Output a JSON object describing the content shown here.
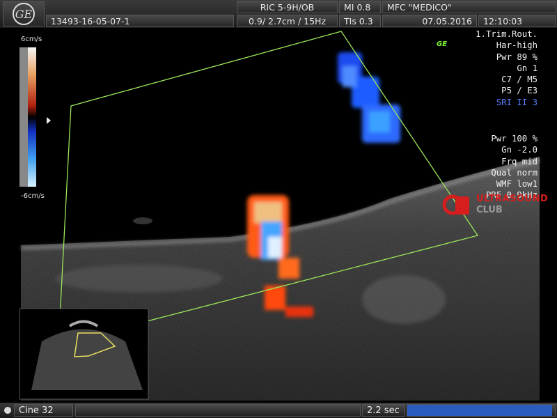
{
  "header": {
    "patient_id": "13493-16-05-07-1",
    "probe": "RIC 5-9H/OB",
    "mi": "MI  0.8",
    "institution": "MFC \"MEDICO\"",
    "depth_freq": "0.9/ 2.7cm / 15Hz",
    "tis": "TIs  0.3",
    "date": "07.05.2016",
    "time": "12:10:03"
  },
  "params_top": [
    "1.Trim.Rout.",
    "Har-high",
    "Pwr  89 %",
    "Gn   1",
    "C7 / M5",
    "P5 / E3",
    "SRI II 3"
  ],
  "params_bottom": [
    "Pwr 100 %",
    "Gn -2.0",
    "Frq mid",
    "Qual norm",
    "WMF low1",
    "PRF  0.9kHz"
  ],
  "color_scale": {
    "max": "6cm/s",
    "min": "-6cm/s"
  },
  "ge_badge": "GE",
  "watermark": {
    "line1": "ULTRASOUND",
    "line2": "CLUB"
  },
  "footer": {
    "cine": "Cine 32",
    "duration": "2.2 sec",
    "progress": 0.98
  },
  "colors": {
    "green_outline": "#9be85a",
    "sri_color": "#5b7dff",
    "brand_red": "#d61e1e",
    "progress_blue": "#2a5cbf"
  }
}
